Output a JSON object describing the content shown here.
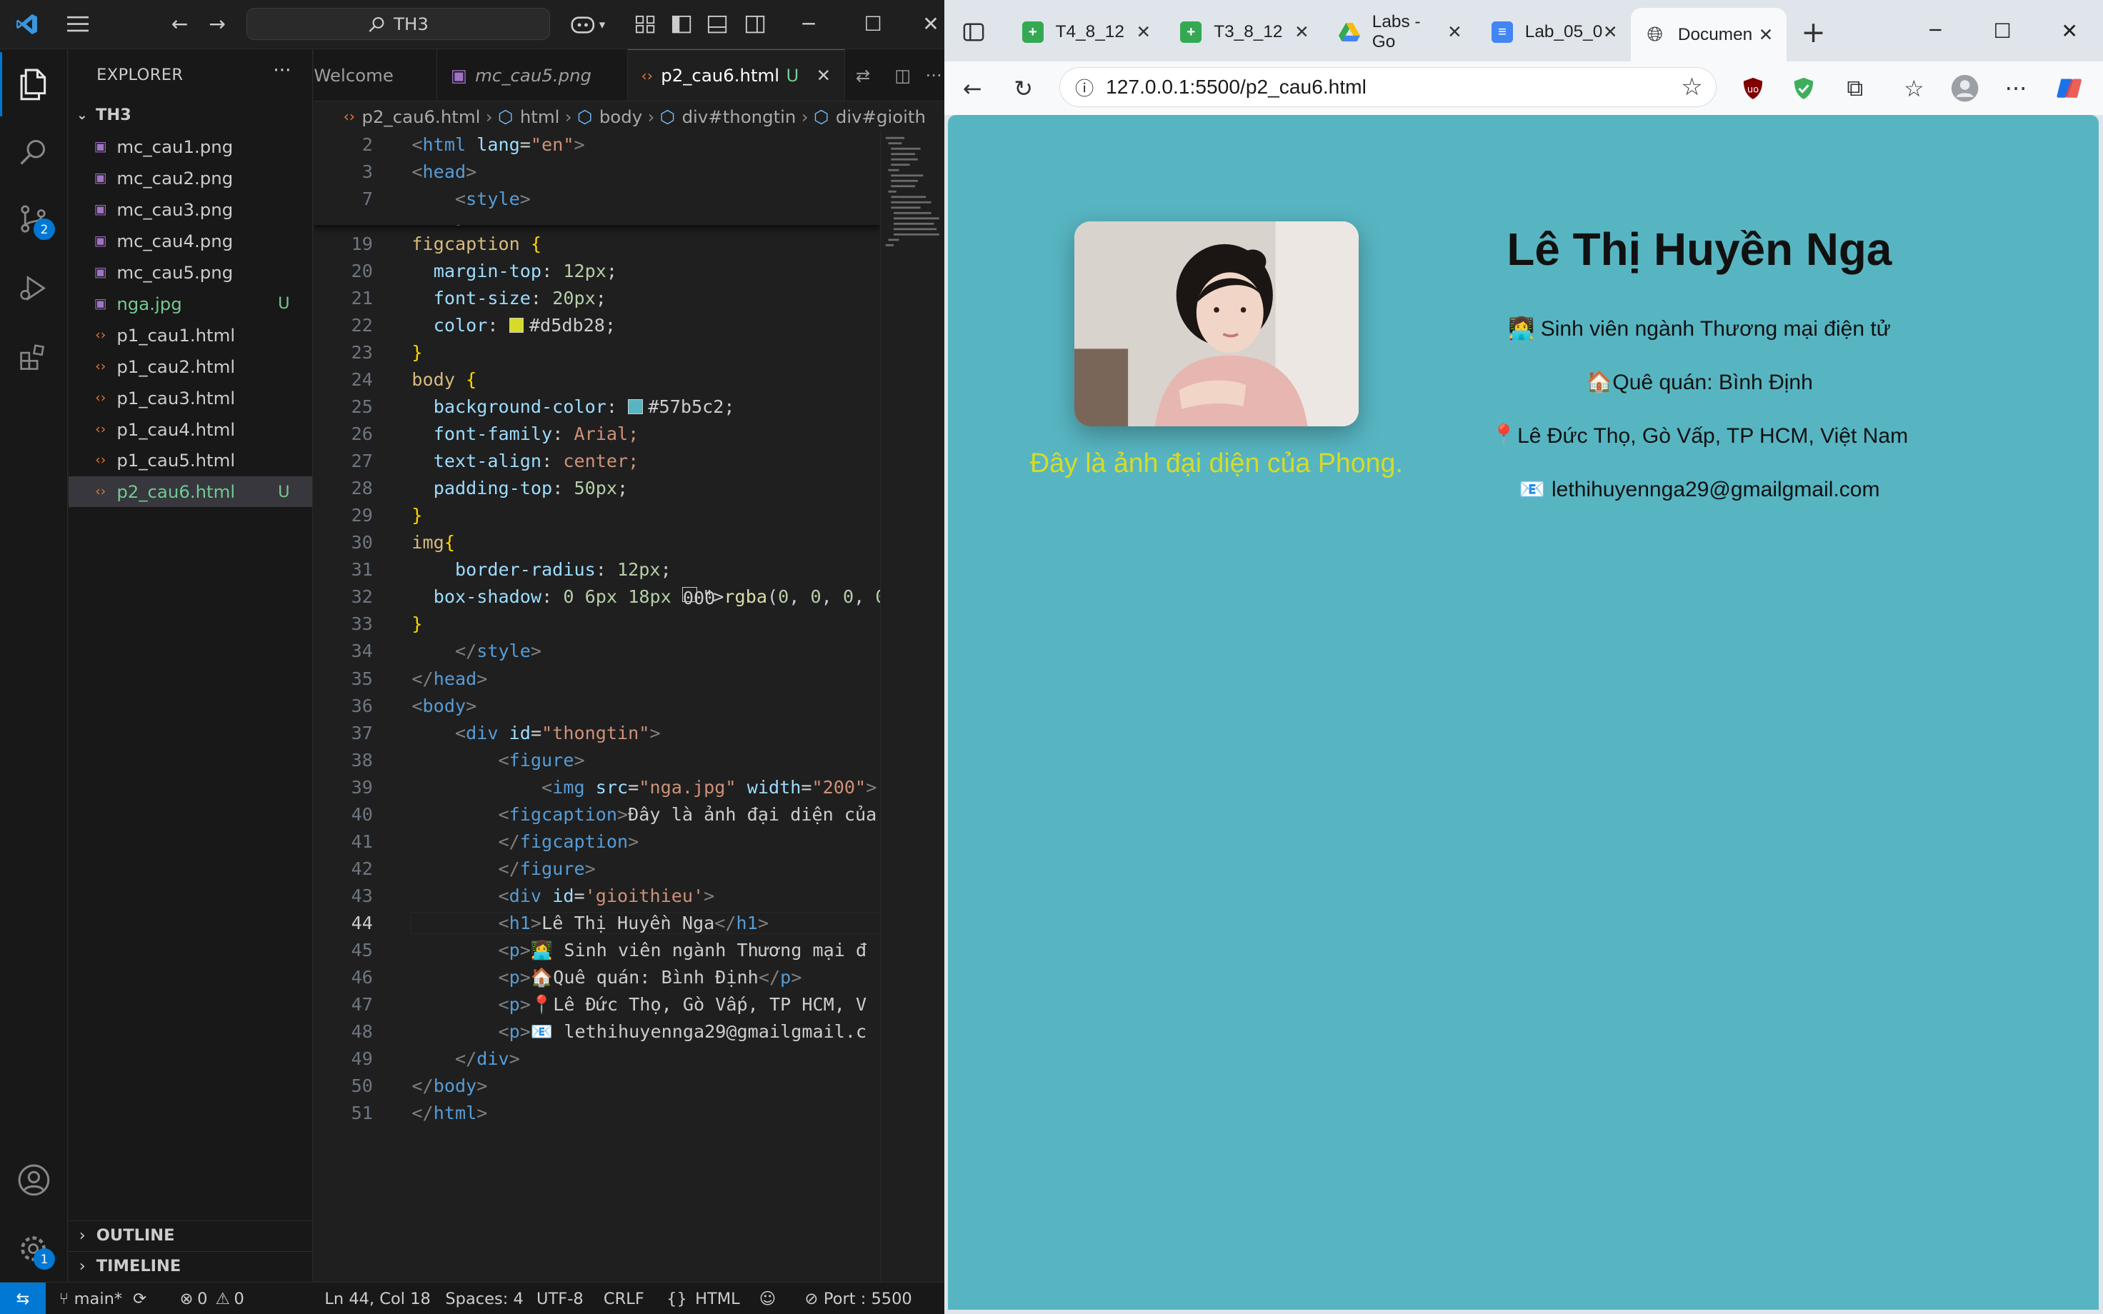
{
  "vscode": {
    "search_text": "TH3",
    "explorer_title": "EXPLORER",
    "folder_name": "TH3",
    "files": [
      {
        "name": "mc_cau1.png",
        "kind": "image",
        "status": ""
      },
      {
        "name": "mc_cau2.png",
        "kind": "image",
        "status": ""
      },
      {
        "name": "mc_cau3.png",
        "kind": "image",
        "status": ""
      },
      {
        "name": "mc_cau4.png",
        "kind": "image",
        "status": ""
      },
      {
        "name": "mc_cau5.png",
        "kind": "image",
        "status": ""
      },
      {
        "name": "nga.jpg",
        "kind": "image",
        "status": "U"
      },
      {
        "name": "p1_cau1.html",
        "kind": "html",
        "status": ""
      },
      {
        "name": "p1_cau2.html",
        "kind": "html",
        "status": ""
      },
      {
        "name": "p1_cau3.html",
        "kind": "html",
        "status": ""
      },
      {
        "name": "p1_cau4.html",
        "kind": "html",
        "status": ""
      },
      {
        "name": "p1_cau5.html",
        "kind": "html",
        "status": ""
      },
      {
        "name": "p2_cau6.html",
        "kind": "html",
        "status": "U"
      }
    ],
    "outline_label": "OUTLINE",
    "timeline_label": "TIMELINE",
    "source_control_badge": "2",
    "settings_badge": "1",
    "tabs": [
      {
        "label": "Welcome"
      },
      {
        "label": "mc_cau5.png"
      },
      {
        "label": "p2_cau6.html",
        "status": "U"
      }
    ],
    "breadcrumb": [
      "p2_cau6.html",
      "html",
      "body",
      "div#thongtin",
      "div#gioith"
    ],
    "sticky_lines": [
      {
        "n": "2",
        "code": "<html lang=\"en\">"
      },
      {
        "n": "3",
        "code": "<head>"
      },
      {
        "n": "7",
        "code": "    <style>"
      }
    ],
    "code_lines": [
      {
        "n": "18",
        "code": "    }"
      },
      {
        "n": "19",
        "code": "figcaption {"
      },
      {
        "n": "20",
        "code": "  margin-top: 12px;"
      },
      {
        "n": "21",
        "code": "  font-size: 20px;"
      },
      {
        "n": "22",
        "code": "  color: #d5db28;"
      },
      {
        "n": "23",
        "code": "}"
      },
      {
        "n": "24",
        "code": "body {"
      },
      {
        "n": "25",
        "code": "  background-color: #57b5c2;"
      },
      {
        "n": "26",
        "code": "  font-family: Arial;"
      },
      {
        "n": "27",
        "code": "  text-align: center;"
      },
      {
        "n": "28",
        "code": "  padding-top: 50px;"
      },
      {
        "n": "29",
        "code": "}"
      },
      {
        "n": "30",
        "code": "img{"
      },
      {
        "n": "31",
        "code": "    border-radius: 12px;"
      },
      {
        "n": "32",
        "code": "  box-shadow: 0 6px 18px rgba(0, 0, 0, 0."
      },
      {
        "n": "33",
        "code": "}"
      },
      {
        "n": "34",
        "code": "    </style>"
      },
      {
        "n": "35",
        "code": "</head>"
      },
      {
        "n": "36",
        "code": "<body>"
      },
      {
        "n": "37",
        "code": "    <div id=\"thongtin\">"
      },
      {
        "n": "38",
        "code": "        <figure>"
      },
      {
        "n": "39",
        "code": "            <img src=\"nga.jpg\" width=\"200\">"
      },
      {
        "n": "40",
        "code": "        <figcaption>Đây là ảnh đại diện của"
      },
      {
        "n": "41",
        "code": "        </figcaption>"
      },
      {
        "n": "42",
        "code": "        </figure>"
      },
      {
        "n": "43",
        "code": "        <div id='gioithieu'>"
      },
      {
        "n": "44",
        "code": "        <h1>Lê Thị Huyền Nga</h1>"
      },
      {
        "n": "45",
        "code": "        <p>👩‍💻 Sinh viên ngành Thương mại đ"
      },
      {
        "n": "46",
        "code": "        <p>🏠Quê quán: Bình Định</p>"
      },
      {
        "n": "47",
        "code": "        <p>📍Lê Đức Thọ, Gò Vấp, TP HCM, V"
      },
      {
        "n": "48",
        "code": "        <p>📧 lethihuyennga29@gmailgmail.c"
      },
      {
        "n": "49",
        "code": "    </div>"
      },
      {
        "n": "50",
        "code": "</body>"
      },
      {
        "n": "51",
        "code": "</html>"
      }
    ],
    "current_line": "44",
    "colors": {
      "figcaption_color": "#d5db28",
      "body_bg": "#57b5c2"
    },
    "status": {
      "branch": "main*",
      "errors": "0",
      "warnings": "0",
      "cursor": "Ln 44, Col 18",
      "spaces": "Spaces: 4",
      "encoding": "UTF-8",
      "eol": "CRLF",
      "language": "HTML",
      "port": "Port : 5500"
    }
  },
  "browser": {
    "tabs": [
      {
        "label": "T4_8_12",
        "icon": "sheets-icon"
      },
      {
        "label": "T3_8_12",
        "icon": "sheets-icon"
      },
      {
        "label": "Labs - Go",
        "icon": "drive-icon"
      },
      {
        "label": "Lab_05_0",
        "icon": "docs-icon"
      },
      {
        "label": "Documen",
        "icon": "globe-icon"
      }
    ],
    "url": "127.0.0.1:5500/p2_cau6.html",
    "page": {
      "figcaption": "Đây là ảnh đại diện của Phong.",
      "name": "Lê Thị Huyền Nga",
      "info": [
        "👩‍💻 Sinh viên ngành Thương mại điện tử",
        "🏠Quê quán: Bình Định",
        "📍Lê Đức Thọ, Gò Vấp, TP HCM, Việt Nam",
        "📧 lethihuyennga29@gmailgmail.com"
      ],
      "bg_color": "#57b5c2",
      "caption_color": "#d5db28"
    }
  }
}
